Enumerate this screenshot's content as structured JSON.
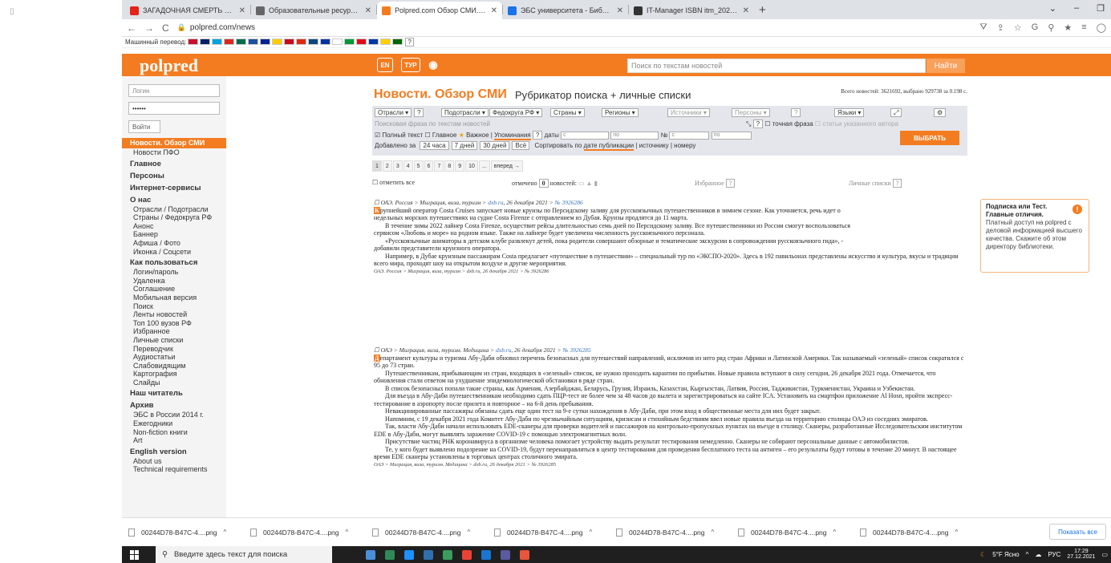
{
  "desktop": {
    "glyph": "▯"
  },
  "browser": {
    "tabs": [
      {
        "title": "ЗАГАДОЧНАЯ СМЕРТЬ НЕВ",
        "icon": "youtube-icon",
        "color": "#e62117",
        "active": false
      },
      {
        "title": "Образовательные ресурсы биб",
        "icon": "wave-icon",
        "color": "#666666",
        "active": false
      },
      {
        "title": "Polpred.com Обзор СМИ. Росси",
        "icon": "polpred-icon",
        "color": "#f47c20",
        "active": true
      },
      {
        "title": "ЭБС университета - Библиотека",
        "icon": "globe-icon",
        "color": "#1a73e8",
        "active": false
      },
      {
        "title": "IT-Manager ISBN itm_2021_06 -",
        "icon": "chart-icon",
        "color": "#333333",
        "active": false
      }
    ],
    "new_tab": "+",
    "window_controls": [
      "⌄",
      "–",
      "❐"
    ],
    "url": "polpred.com/news",
    "nav": [
      "←",
      "→",
      "C"
    ],
    "lock": "🔒",
    "ext_icons": [
      "⛛",
      "⇪",
      "☆",
      "G",
      "⚲",
      "★",
      "≡",
      "◯"
    ]
  },
  "translator": {
    "label": "Машинный перевод:",
    "help": "?",
    "flags": [
      "#c8102e",
      "#012169",
      "#00a3e0",
      "#da291c",
      "#006a4e",
      "#1e50a0",
      "#002395",
      "#ffcc00",
      "#c60b1e",
      "#de2910",
      "#11457e",
      "#0033a0",
      "#ffffff",
      "#009639",
      "#e30a17",
      "#0039a6",
      "#ffce00",
      "#006600"
    ]
  },
  "header": {
    "logo": "polpred",
    "lang_btn": "EN",
    "tur_btn": "ТУР",
    "eye": "◉",
    "search_placeholder": "Поиск по текстам новостей",
    "search_btn": "Найти"
  },
  "sidebar": {
    "login_placeholder": "Логин",
    "password_value": "••••••",
    "login_btn": "Войти",
    "items": [
      {
        "label": "Новости. Обзор СМИ",
        "kind": "act"
      },
      {
        "label": "Новости ПФО",
        "kind": ""
      },
      {
        "label": "Главное",
        "kind": "h"
      },
      {
        "label": "Персоны",
        "kind": "h"
      },
      {
        "label": "Интернет-сервисы",
        "kind": "h"
      },
      {
        "label": "О нас",
        "kind": "h"
      },
      {
        "label": "Отрасли / Подотрасли",
        "kind": ""
      },
      {
        "label": "Страны / Федокруга РФ",
        "kind": ""
      },
      {
        "label": "Анонс",
        "kind": ""
      },
      {
        "label": "Баннер",
        "kind": ""
      },
      {
        "label": "Афиша / Фото",
        "kind": ""
      },
      {
        "label": "Иконка / Соцсети",
        "kind": ""
      },
      {
        "label": "Как пользоваться",
        "kind": "h"
      },
      {
        "label": "Логин/пароль",
        "kind": ""
      },
      {
        "label": "Удаленка",
        "kind": ""
      },
      {
        "label": "Соглашение",
        "kind": ""
      },
      {
        "label": "Мобильная версия",
        "kind": ""
      },
      {
        "label": "Поиск",
        "kind": ""
      },
      {
        "label": "Ленты новостей",
        "kind": ""
      },
      {
        "label": "Топ 100 вузов РФ",
        "kind": ""
      },
      {
        "label": "Избранное",
        "kind": ""
      },
      {
        "label": "Личные списки",
        "kind": ""
      },
      {
        "label": "Переводчик",
        "kind": ""
      },
      {
        "label": "Аудиостатьи",
        "kind": ""
      },
      {
        "label": "Слабовидящим",
        "kind": ""
      },
      {
        "label": "Картография",
        "kind": ""
      },
      {
        "label": "Слайды",
        "kind": ""
      },
      {
        "label": "Наш читатель",
        "kind": "h"
      },
      {
        "label": "Архив",
        "kind": "h"
      },
      {
        "label": "ЭБС в России 2014 г.",
        "kind": ""
      },
      {
        "label": "Ежегодники",
        "kind": ""
      },
      {
        "label": "Non-fiction книги",
        "kind": ""
      },
      {
        "label": "Art",
        "kind": ""
      },
      {
        "label": "English version",
        "kind": "h"
      },
      {
        "label": "About us",
        "kind": ""
      },
      {
        "label": "Technical requirements",
        "kind": ""
      }
    ]
  },
  "main": {
    "title": "Новости. Обзор СМИ",
    "subtitle": "Рубрикатор поиска + личные списки",
    "total": "Всего новостей: 3621692, выбрано 929738 за 0.198 с.",
    "filters": [
      {
        "label": "Отрасли ▾",
        "dim": false
      },
      {
        "label": "?",
        "dim": false
      },
      {
        "label": "Подотрасли ▾",
        "dim": false
      },
      {
        "label": "Федокруга РФ ▾",
        "dim": false
      },
      {
        "label": "Страны ▾",
        "dim": false
      },
      {
        "label": "Регионы ▾",
        "dim": false
      },
      {
        "label": "Источники ▾",
        "dim": true
      },
      {
        "label": "Персоны ▾",
        "dim": true
      },
      {
        "label": "?",
        "dim": true
      },
      {
        "label": "Языки ▾",
        "dim": false
      },
      {
        "label": "⤢",
        "dim": false
      },
      {
        "label": "⚙",
        "dim": false
      }
    ],
    "phrase_placeholder": "Поисковая фраза по текстам новостей",
    "exact_phrase": "точная фраза",
    "author_articles": "статьи указанного автора",
    "row3": {
      "full_text": "Полный текст",
      "main": "Главное",
      "important": "Важное",
      "mentions": "Упоминания",
      "help": "?",
      "dates": "даты",
      "from": "с",
      "to": "по",
      "num": "№",
      "num_from": "с",
      "num_to": "по"
    },
    "row4": {
      "added": "Добавлено за",
      "periods": [
        "24 часа",
        "7 дней",
        "30 дней",
        "Всё"
      ],
      "sort": "Сортировать по",
      "sort_opts": [
        "дате публикации",
        "источнику",
        "номеру"
      ]
    },
    "choose_btn": "ВЫБРАТЬ",
    "pages": [
      "1",
      "2",
      "3",
      "4",
      "5",
      "6",
      "7",
      "8",
      "9",
      "10",
      "...",
      "вперед →"
    ],
    "mark_all": "отметить все",
    "marked": "отмечено",
    "marked_count": "0",
    "news_label": "новостей:",
    "favorites": "Избранное",
    "personal_lists": "Личные списки",
    "help": "?"
  },
  "articles": [
    {
      "meta": "ОАЭ. Россия > Миграция, виза, туризм >",
      "source": "dxb.ru",
      "date": ", 26 декабря 2021 >",
      "num": "№ 3926286",
      "drop": "К",
      "paras": [
        "рупнейший оператор Costa Cruises запускает новые круизы по Персидскому заливу для русскоязычных путешественников в зимнем сезоне. Как уточняется, речь идет о недельных морских путешествиях на судне Costa Firenze с отправлением из Дубая. Круизы продлятся до 11 марта.",
        "В течение зимы 2022 лайнер Costa Firenze, осуществит рейсы длительностью семь дней по Персидскому заливу. Все путешественники из России смогут воспользоваться сервисом «Любовь и море» на родном языке. Также на лайнере будет увеличена численность русскоязычного персонала.",
        "«Русскоязычные аниматоры в детском клубе развлекут детей, пока родители совершают обзорные и тематические экскурсии в сопровождении русскоязычного гида», - добавили представители круизного оператора.",
        "Например, в Дубае круизным пассажирам Costa предлагает «путешествие в путешествии» – специальный тур по «ЭКСПО-2020». Здесь в 192 павильонах представлены искусство и культура, вкусы и традиции всего мира, проходят шоу на открытом воздухе и другие мероприятия."
      ],
      "footer": "ОАЭ. Россия > Миграция, виза, туризм > dxb.ru, 26 декабря 2021 > № 3926286"
    },
    {
      "meta": "ОАЭ > Миграция, виза, туризм. Медицина >",
      "source": "dxb.ru",
      "date": ", 26 декабря 2021 >",
      "num": "№ 3926285",
      "drop": "Д",
      "paras": [
        "епартамент культуры и туризма Абу-Даби обновил перечень безопасных для путешествий направлений, исключив из него ряд стран Африки и Латинской Америки. Так называемый «зеленый» список сократился с 95 до 73 стран.",
        "Путешественникам, прибывающим из стран, входящих в «зеленый» список, не нужно проходить карантин по прибытии. Новые правила вступают в силу сегодня, 26 декабря 2021 года. Отмечается, что обновления стали ответом на ухудшение эпидемиологической обстановки в ряде стран.",
        "В список безопасных попали такие страны, как Армения, Азербайджан, Беларусь, Грузия, Израиль, Казахстан, Кыргызстан, Латвия, Россия, Таджикистан, Туркменистан, Украина и Узбекистан.",
        "Для въезда в Абу-Даби путешественникам необходимо сдать ПЦР-тест не более чем за 48 часов до вылета и зарегистрироваться на сайте ICA. Установить на смартфон приложение Al Hosn, пройти экспресс-тестирование в аэропорту после прилета и повторное – на 6-й день пребывания.",
        "Невакцинированные пассажиры обязаны сдать еще один тест на 9-е сутки нахождения в Абу-Даби, при этом вход в общественные места для них будет закрыт.",
        "Напомним, с 19 декабря 2021 года Комитет Абу-Даби по чрезвычайным ситуациям, кризисам и стихийным бедствиям ввел новые правила въезда на территорию столицы ОАЭ из соседних эмиратов.",
        "Так, власти Абу-Даби начали использовать EDE-сканеры для проверки водителей и пассажиров на контрольно-пропускных пунктах на въезде в столицу. Сканеры, разработанные Исследовательским институтом EDE в Абу-Даби, могут выявлять заражение COVID-19 с помощью электромагнитных волн.",
        "Присутствие частиц РНК коронавируса в организме человека помогает устройству выдать результат тестирования немедленно. Сканеры не собирают персональные данные с автомобилистов.",
        "Те, у кого будет выявлено подозрение на COVID-19, будут перенаправляться в центр тестирования для проведения бесплатного теста на антиген – его результаты будут готовы в течение 20 минут. В настоящее время EDE сканеры установлены в торговых центрах столичного эмирата."
      ],
      "footer": "ОАЭ > Миграция, виза, туризм. Медицина > dxb.ru, 26 декабря 2021 > № 3926285"
    }
  ],
  "promo": {
    "title": "Подписка или Тест. Главные отличия.",
    "text": "Платный доступ на polpred с деловой информацией высшего качества. Скажите об этом директору библиотеки.",
    "bang": "!"
  },
  "downloads": {
    "files": [
      "00244D78-B47C-4....png",
      "00244D78-B47C-4....png",
      "00244D78-B47C-4....png",
      "00244D78-B47C-4....png",
      "00244D78-B47C-4....png",
      "00244D78-B47C-4....png",
      "00244D78-B47C-4....png"
    ],
    "caret": "^",
    "show_all": "Показать все"
  },
  "taskbar": {
    "search": "Введите здесь текст для поиска",
    "apps": [
      "#4a90d9",
      "#2e8b57",
      "#1e90ff",
      "#2f6fb0",
      "#3a9d5d",
      "#ea4335",
      "#1976d2",
      "#5a5aa0",
      "#e8553a"
    ],
    "weather": "5°F Ясно",
    "lang": "РУС",
    "time": "17:29",
    "date": "27.12.2021"
  }
}
